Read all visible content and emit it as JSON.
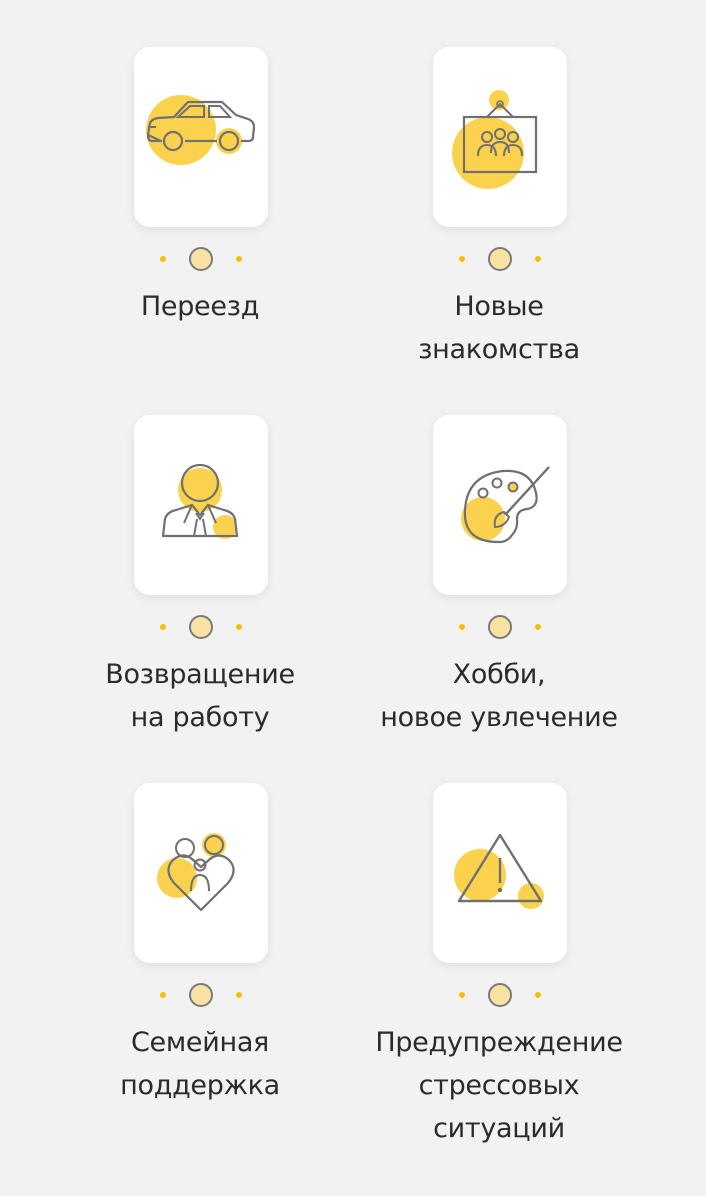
{
  "colors": {
    "background": "#f2f2f2",
    "accent_yellow": "#fbd24e",
    "outline_gray": "#707070",
    "text": "#2b2b2b"
  },
  "items": [
    {
      "icon": "car-icon",
      "label_lines": [
        "Переезд"
      ]
    },
    {
      "icon": "people-board-icon",
      "label_lines": [
        "Новые",
        "знакомства"
      ]
    },
    {
      "icon": "businessman-icon",
      "label_lines": [
        "Возвращение",
        "на работу"
      ]
    },
    {
      "icon": "palette-icon",
      "label_lines": [
        "Хобби,",
        "новое увлечение"
      ]
    },
    {
      "icon": "family-heart-icon",
      "label_lines": [
        "Семейная",
        "поддержка"
      ]
    },
    {
      "icon": "warning-triangle-icon",
      "label_lines": [
        "Предупреждение",
        "стрессовых",
        "ситуаций"
      ]
    }
  ]
}
